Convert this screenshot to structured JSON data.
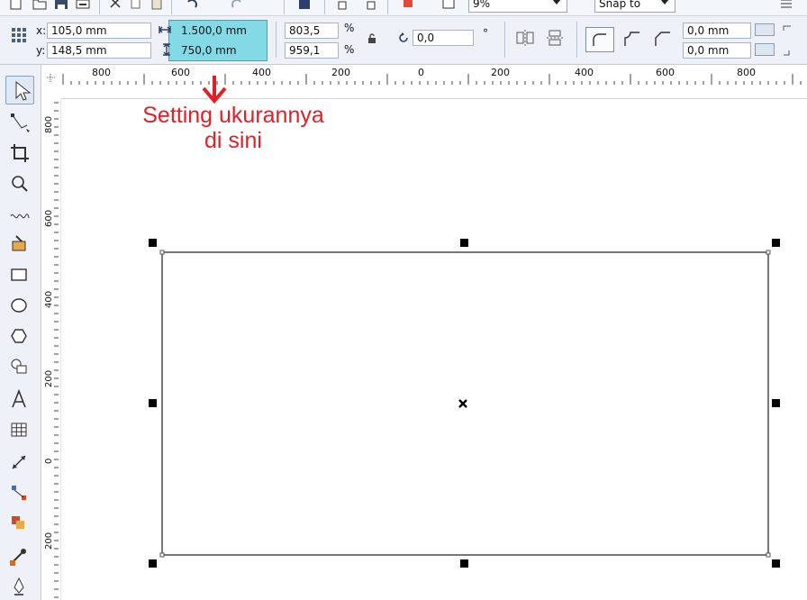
{
  "standard_toolbar": {
    "zoom_value": "9%",
    "snap_label": "Snap to"
  },
  "property_bar": {
    "x_label": "x:",
    "x_value": "105,0 mm",
    "y_label": "y:",
    "y_value": "148,5 mm",
    "width_value": "1.500,0 mm",
    "height_value": "750,0 mm",
    "scale_x": "803,5",
    "scale_y": "959,1",
    "percent_symbol": "%",
    "rotation_value": "0,0",
    "degree_symbol": "°",
    "corner_radius_top": "0,0 mm",
    "corner_radius_bottom": "0,0 mm"
  },
  "ruler": {
    "top_labels": [
      "800",
      "600",
      "400",
      "200",
      "0",
      "200",
      "400",
      "600",
      "800"
    ],
    "left_labels": [
      "800",
      "600",
      "400",
      "200",
      "0",
      "200"
    ]
  },
  "toolbox": {
    "tools": [
      "pick-tool",
      "shape-tool",
      "crop-tool",
      "zoom-tool",
      "freehand-tool",
      "smart-fill-tool",
      "rectangle-tool",
      "ellipse-tool",
      "polygon-tool",
      "basic-shapes-tool",
      "text-tool",
      "table-tool",
      "dimension-tool",
      "connector-tool",
      "blend-tool",
      "eyedropper-tool",
      "outline-tool"
    ]
  },
  "annotation": {
    "line1": "Setting ukurannya",
    "line2": "di sini",
    "color": "#e21f26"
  },
  "colors": {
    "highlight": "#84d9e6",
    "annotation_red": "#e21f26",
    "toolbar_bg": "#eef2f8"
  }
}
